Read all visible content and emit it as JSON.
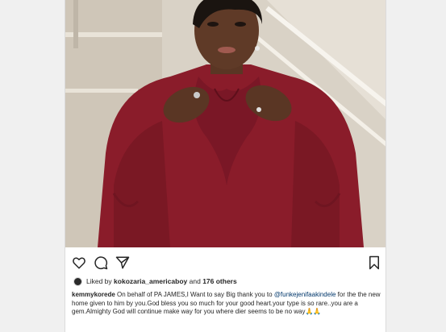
{
  "post": {
    "likes": {
      "prefix": "Liked by ",
      "user": "kokozaria_americaboy",
      "middle": " and ",
      "others": "176 others"
    },
    "caption": {
      "username": "kemmykorede",
      "text_1": " On behalf of PA JAMES,I Want to say Big thank you to ",
      "mention": "@funkejenifaakindele",
      "text_2": " for the the new home given to him by you.God bless you so much for your good heart.your type is so rare..you are a gem.Almighty God will continue make way for you where dier seems to be no way",
      "emoji": "🙏🙏"
    },
    "icons": {
      "like": "heart-icon",
      "comment": "comment-icon",
      "share": "share-icon",
      "save": "bookmark-icon"
    },
    "colors": {
      "dress": "#8a1c2a",
      "text": "#262626",
      "mention": "#00376b"
    }
  }
}
